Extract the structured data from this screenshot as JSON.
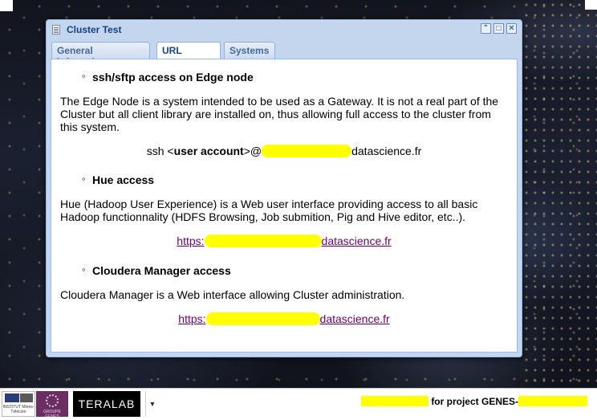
{
  "window": {
    "title": "Cluster Test",
    "tabs": [
      {
        "label": "General infomation",
        "active": false
      },
      {
        "label": "URL access",
        "active": true
      },
      {
        "label": "Systems",
        "active": false
      }
    ]
  },
  "sections": [
    {
      "heading": "ssh/sftp access on Edge node",
      "text": "The Edge Node is a system intended to be used as a Gateway. It is not a real part of the Cluster but all client library are installed on, thus allowing full access to the cluster from this system.",
      "command_prefix": "ssh <",
      "command_user": "user account",
      "command_mid": ">@",
      "command_suffix": "datascience.fr"
    },
    {
      "heading": "Hue access",
      "text": "Hue (Hadoop User Experience) is a Web user interface providing access to all basic Hadoop functionnality (HDFS Browsing, Job submition, Pig and Hive editor, etc..).",
      "link_prefix": "https:",
      "link_suffix": "datascience.fr"
    },
    {
      "heading": "Cloudera Manager access",
      "text": "Cloudera Manager is a Web interface allowing Cluster administration.",
      "link_prefix": "https:",
      "link_suffix": "datascience.fr"
    }
  ],
  "taskbar": {
    "logo_imt_text": "INSTITUT Mines-Télécom",
    "logo_genes_text": "GROUPE GENES",
    "teralab_label": "TERALAB",
    "project_text": "for project GENES-"
  },
  "colors": {
    "highlight": "#ffff00",
    "title": "#15428b",
    "link": "#6e006e"
  }
}
